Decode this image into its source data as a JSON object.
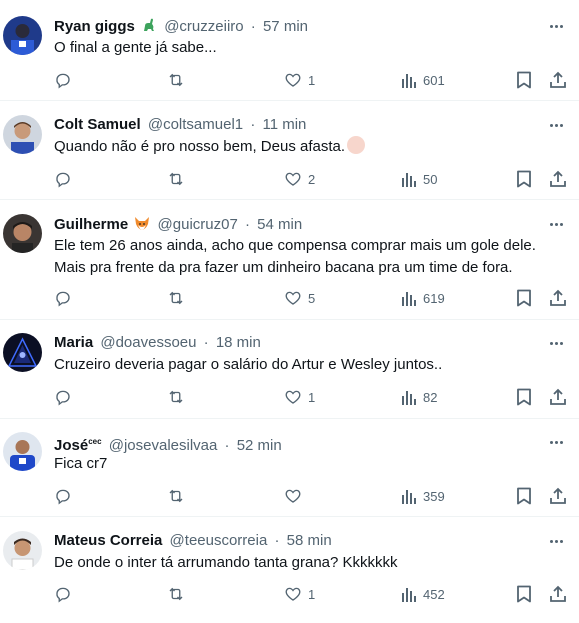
{
  "colors": {
    "text_primary": "#0f1419",
    "text_secondary": "#536471",
    "divider": "#eff3f4"
  },
  "icons": {
    "reply": "reply-icon",
    "retweet": "retweet-icon",
    "like": "heart-icon",
    "views": "views-icon",
    "bookmark": "bookmark-icon",
    "share": "share-icon",
    "more": "more-icon"
  },
  "tweets": [
    {
      "name": "Ryan giggs",
      "badge": "dinosaur-emoji",
      "handle": "@cruzzeiiro",
      "time": "57 min",
      "lines": [
        "O final a gente já sabe..."
      ],
      "likes": "1",
      "views": "601"
    },
    {
      "name": "Colt Samuel",
      "handle": "@coltsamuel1",
      "time": "11 min",
      "lines": [
        "Quando não é pro nosso bem, Deus afasta."
      ],
      "likes": "2",
      "views": "50"
    },
    {
      "name": "Guilherme",
      "badge": "fox-emoji",
      "handle": "@guicruz07",
      "time": "54 min",
      "lines": [
        "Ele tem 26 anos ainda, acho que compensa comprar mais um gole dele.",
        "Mais pra frente da pra fazer um dinheiro bacana pra um time de fora."
      ],
      "likes": "5",
      "views": "619"
    },
    {
      "name": "Maria",
      "handle": "@doavessoeu",
      "time": "18 min",
      "lines": [
        "Cruzeiro deveria pagar o salário do Artur e Wesley juntos.."
      ],
      "likes": "1",
      "views": "82"
    },
    {
      "name": "José",
      "name_suffix": "cec",
      "handle": "@josevalesilvaa",
      "time": "52 min",
      "lines": [
        "Fica cr7"
      ],
      "likes": "",
      "views": "359"
    },
    {
      "name": "Mateus Correia",
      "handle": "@teeuscorreia",
      "time": "58 min",
      "lines": [
        "De onde o inter tá arrumando tanta grana? Kkkkkkk"
      ],
      "likes": "1",
      "views": "452"
    }
  ]
}
